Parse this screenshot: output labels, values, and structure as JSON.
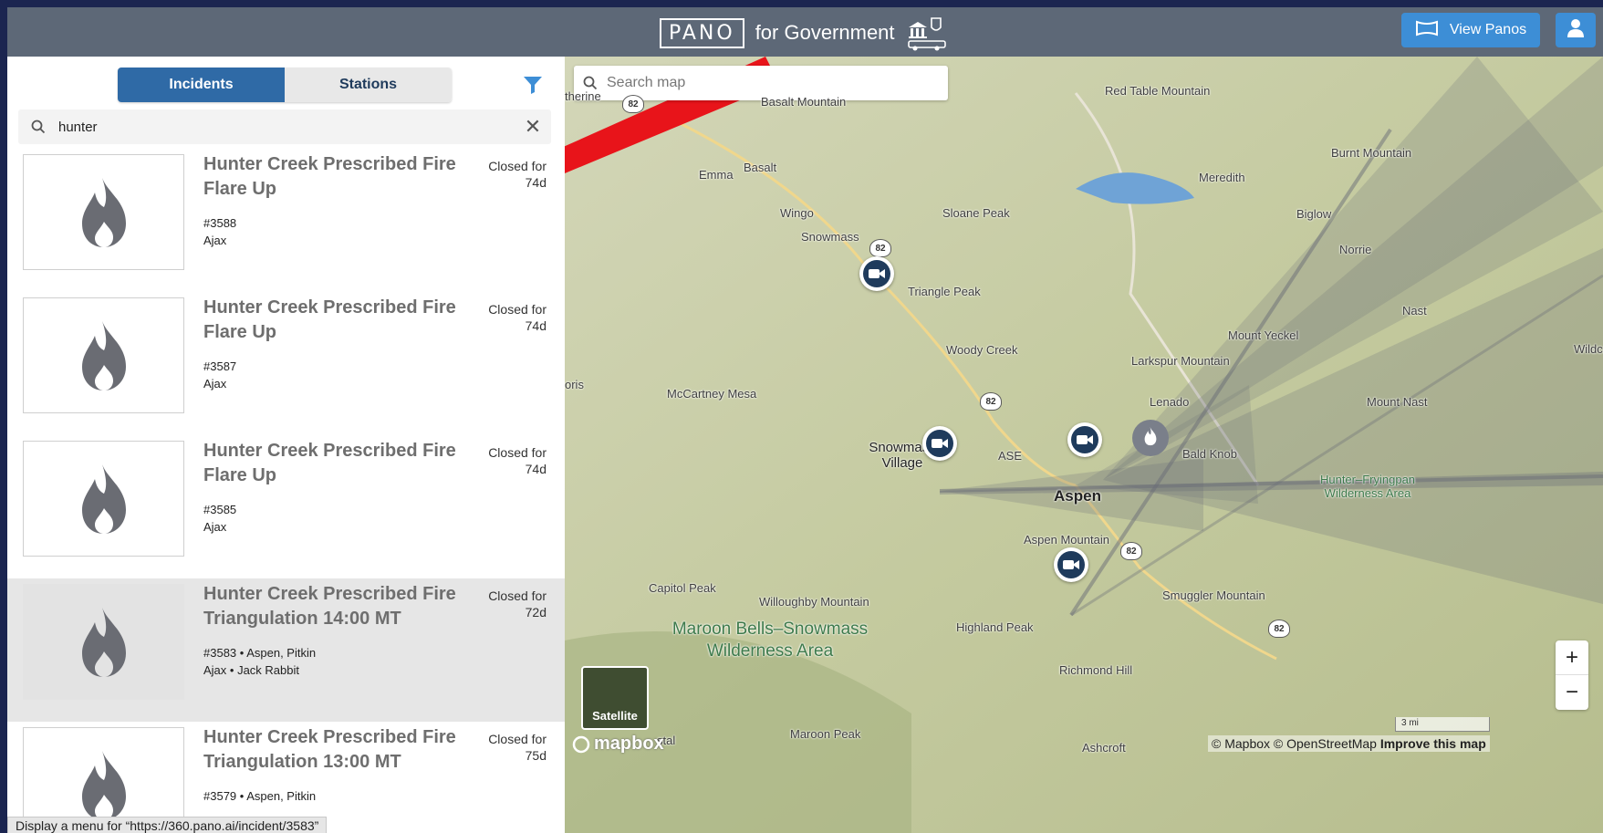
{
  "header": {
    "logo": "PANO",
    "product": "for Government",
    "view_button": "View Panos"
  },
  "sidebar": {
    "tabs": [
      "Incidents",
      "Stations"
    ],
    "active_tab": "Incidents",
    "search_value": "hunter",
    "items": [
      {
        "title": "Hunter Creek Prescribed Fire Flare Up",
        "status": "Closed for 74d",
        "line1": "#3588",
        "line2": "Ajax",
        "highlighted": false
      },
      {
        "title": "Hunter Creek Prescribed Fire Flare Up",
        "status": "Closed for 74d",
        "line1": "#3587",
        "line2": "Ajax",
        "highlighted": false
      },
      {
        "title": "Hunter Creek Prescribed Fire Flare Up",
        "status": "Closed for 74d",
        "line1": "#3585",
        "line2": "Ajax",
        "highlighted": false
      },
      {
        "title": "Hunter Creek Prescribed Fire Triangulation 14:00 MT",
        "status": "Closed for 72d",
        "line1": "#3583 • Aspen, Pitkin",
        "line2": "Ajax • Jack Rabbit",
        "highlighted": true
      },
      {
        "title": "Hunter Creek Prescribed Fire Triangulation 13:00 MT",
        "status": "Closed for 75d",
        "line1": "#3579 • Aspen, Pitkin",
        "line2": "",
        "highlighted": false
      }
    ],
    "hover_status": "Display a menu for “https://360.pano.ai/incident/3583”"
  },
  "map": {
    "search_placeholder": "Search map",
    "satellite_label": "Satellite",
    "mapbox_logo": "mapbox",
    "scale": "3 mi",
    "attribution": "© Mapbox © OpenStreetMap",
    "improve": "Improve this map",
    "labels": {
      "red_table": "Red Table Mountain",
      "burnt": "Burnt Mountain",
      "meredith": "Meredith",
      "basalt_mtn": "Basalt Mountain",
      "therine": "therine",
      "emma": "Emma",
      "basalt": "Basalt",
      "wingo": "Wingo",
      "sloane": "Sloane Peak",
      "biglow": "Biglow",
      "norrie": "Norrie",
      "snowmass": "Snowmass",
      "triangle": "Triangle Peak",
      "nast": "Nast",
      "mount_yeckel": "Mount Yeckel",
      "wildca": "Wildca",
      "woody": "Woody Creek",
      "larkspur": "Larkspur Mountain",
      "oris": "oris",
      "mccartney": "McCartney Mesa",
      "lenado": "Lenado",
      "mount_nast": "Mount Nast",
      "snowmass_village": "Snowmass Village",
      "ase": "ASE",
      "bald_knob": "Bald Knob",
      "hunter_fryingpan": "Hunter–Fryingpan Wilderness Area",
      "aspen": "Aspen",
      "aspen_mtn": "Aspen Mountain",
      "capitol": "Capitol Peak",
      "willoughby": "Willoughby Mountain",
      "smuggler": "Smuggler Mountain",
      "maroon_bells": "Maroon Bells–Snowmass Wilderness Area",
      "highland": "Highland Peak",
      "richmond": "Richmond Hill",
      "maroon_peak": "Maroon Peak",
      "crystal": "stal",
      "ashcroft": "Ashcroft"
    },
    "highway": "82"
  },
  "colors": {
    "accent": "#3d8ed6",
    "tab_active": "#2f6aa6",
    "annotation_arrow": "#e8141a"
  }
}
